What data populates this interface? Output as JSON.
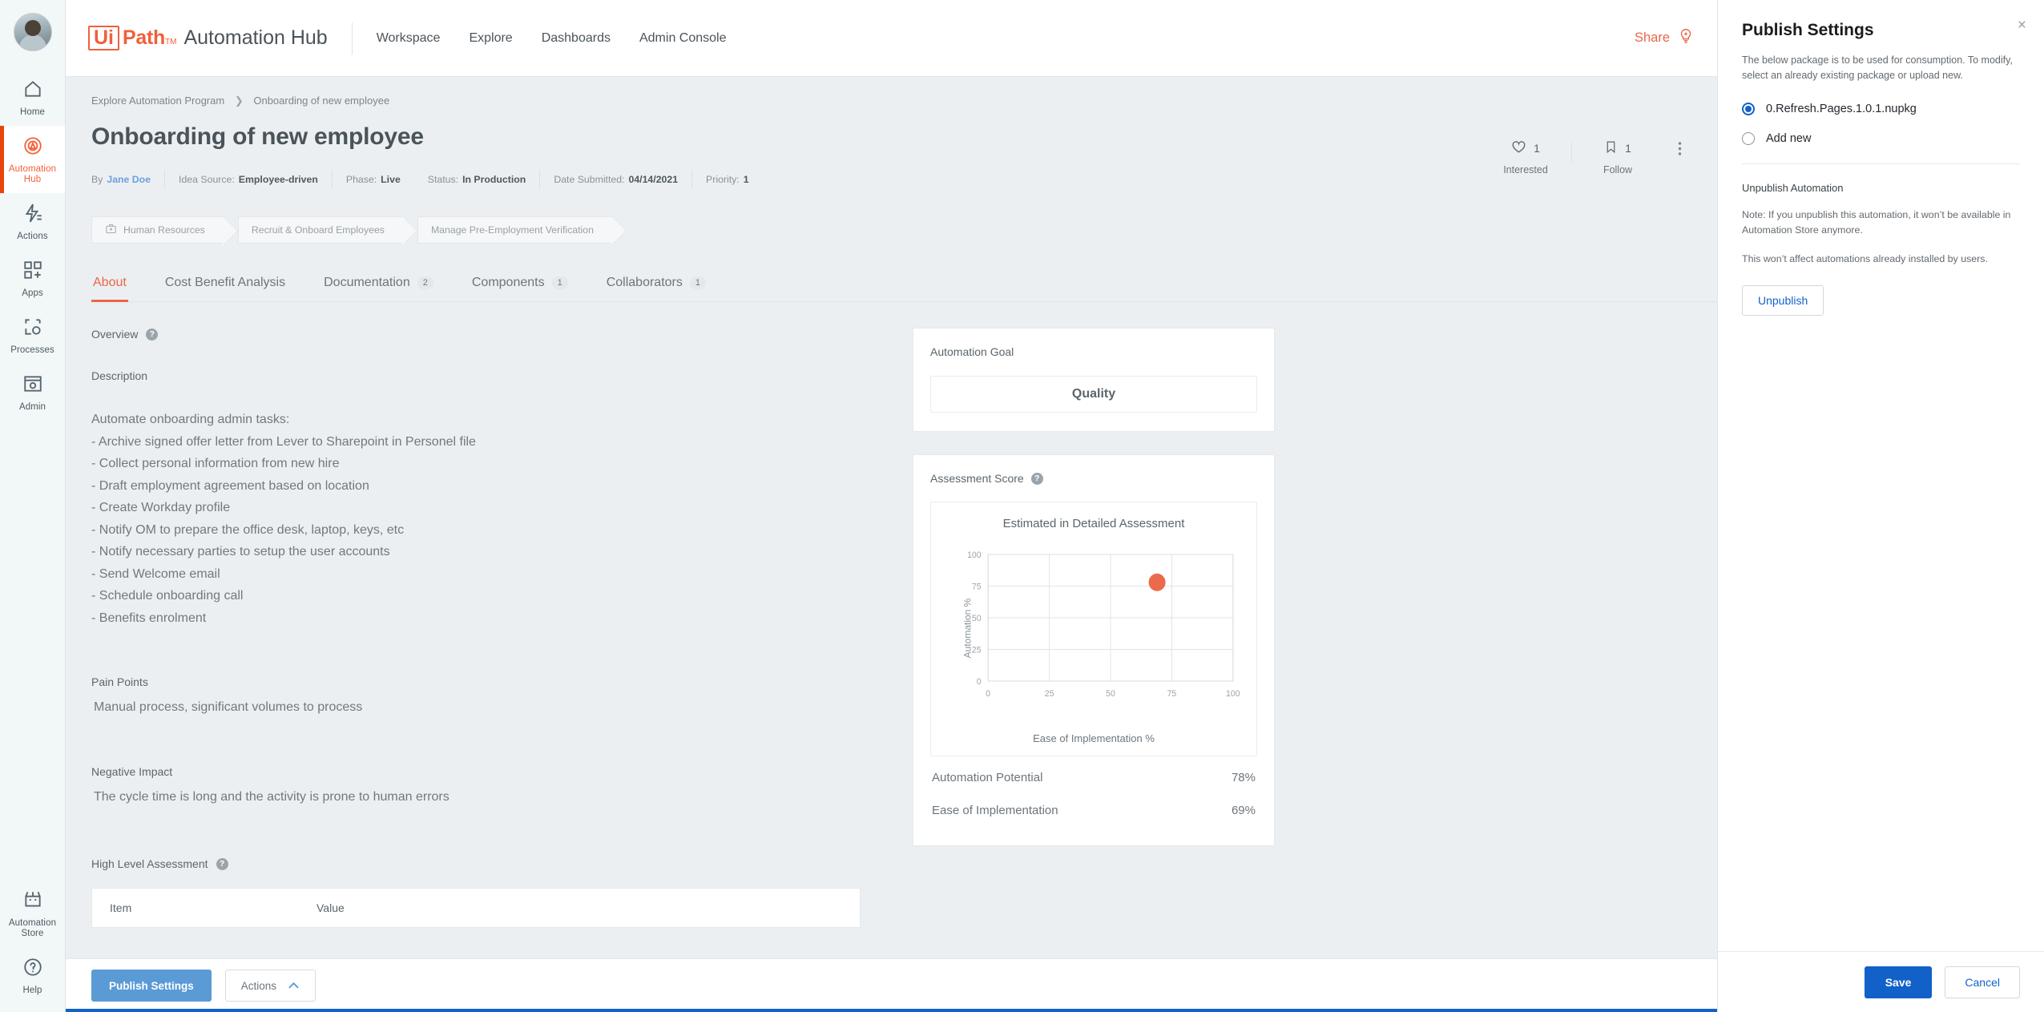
{
  "rail": {
    "items": [
      {
        "label": "Home",
        "icon": "home-icon",
        "active": false
      },
      {
        "label": "Automation Hub",
        "icon": "automation-hub-icon",
        "active": true
      },
      {
        "label": "Actions",
        "icon": "actions-icon",
        "active": false
      },
      {
        "label": "Apps",
        "icon": "apps-icon",
        "active": false
      },
      {
        "label": "Processes",
        "icon": "processes-icon",
        "active": false
      },
      {
        "label": "Admin",
        "icon": "admin-icon",
        "active": false
      }
    ],
    "bottom": [
      {
        "label": "Automation Store",
        "icon": "automation-store-icon"
      },
      {
        "label": "Help",
        "icon": "help-icon"
      }
    ]
  },
  "topbar": {
    "logo_ui": "Ui",
    "logo_path": "Path",
    "logo_tm": "TM",
    "product": "Automation Hub",
    "nav": [
      {
        "label": "Workspace"
      },
      {
        "label": "Explore"
      },
      {
        "label": "Dashboards"
      },
      {
        "label": "Admin Console"
      }
    ],
    "share_label": "Share"
  },
  "breadcrumb": {
    "parent": "Explore Automation Program",
    "separator": "❯",
    "current": "Onboarding of new employee"
  },
  "page": {
    "title": "Onboarding of new employee"
  },
  "meta": {
    "by_label": "By",
    "author": "Jane Doe",
    "items": [
      {
        "key": "Idea Source:",
        "value": "Employee-driven"
      },
      {
        "key": "Phase:",
        "value": "Live"
      },
      {
        "key": "Status:",
        "value": "In Production"
      },
      {
        "key": "Date Submitted:",
        "value": "04/14/2021"
      },
      {
        "key": "Priority:",
        "value": "1"
      }
    ]
  },
  "engagement": {
    "interested_count": "1",
    "interested_label": "Interested",
    "follow_count": "1",
    "follow_label": "Follow"
  },
  "chips": [
    {
      "label": "Human Resources",
      "icon": "briefcase-icon"
    },
    {
      "label": "Recruit & Onboard Employees",
      "icon": ""
    },
    {
      "label": "Manage Pre-Employment Verification",
      "icon": ""
    }
  ],
  "tabs": [
    {
      "label": "About",
      "badge": "",
      "active": true
    },
    {
      "label": "Cost Benefit Analysis",
      "badge": "",
      "active": false
    },
    {
      "label": "Documentation",
      "badge": "2",
      "active": false
    },
    {
      "label": "Components",
      "badge": "1",
      "active": false
    },
    {
      "label": "Collaborators",
      "badge": "1",
      "active": false
    }
  ],
  "about": {
    "overview_label": "Overview",
    "description_label": "Description",
    "description_lines": [
      "Automate onboarding admin tasks:",
      "- Archive signed offer letter from Lever to Sharepoint in Personel file",
      "- Collect personal information from new hire",
      "- Draft employment agreement based on location",
      "- Create Workday profile",
      "- Notify OM to prepare the office desk, laptop, keys, etc",
      "- Notify necessary parties to setup the user accounts",
      "- Send Welcome email",
      "- Schedule onboarding call",
      "- Benefits enrolment"
    ],
    "pain_points_label": "Pain Points",
    "pain_points_text": "Manual process, significant volumes to process",
    "negative_impact_label": "Negative Impact",
    "negative_impact_text": "The cycle time is long and the activity is prone to human errors",
    "high_level_assessment_label": "High Level Assessment",
    "hl_table_headers": [
      "Item",
      "Value"
    ]
  },
  "automation_goal": {
    "title": "Automation Goal",
    "value": "Quality"
  },
  "assessment": {
    "title": "Assessment Score",
    "metrics": [
      {
        "label": "Automation Potential",
        "value": "78%"
      },
      {
        "label": "Ease of Implementation",
        "value": "69%"
      }
    ]
  },
  "chart_data": {
    "type": "scatter",
    "title": "Estimated in Detailed Assessment",
    "xlabel": "Ease of Implementation %",
    "ylabel": "Automation %",
    "xlim": [
      0,
      100
    ],
    "ylim": [
      0,
      100
    ],
    "xticks": [
      "0",
      "25",
      "50",
      "75",
      "100"
    ],
    "yticks": [
      "0",
      "25",
      "50",
      "75",
      "100"
    ],
    "grid": true,
    "legend": "none",
    "point_color": "#ec6a4c",
    "series": [
      {
        "name": "Onboarding of new employee",
        "x": [
          69
        ],
        "y": [
          78
        ]
      }
    ]
  },
  "bottom_bar": {
    "publish_settings_label": "Publish Settings",
    "actions_label": "Actions",
    "actions_caret": "⌃"
  },
  "publish_panel": {
    "title": "Publish Settings",
    "close_glyph": "×",
    "description": "The below package is to be used for consumption. To modify, select an already existing package or upload new.",
    "options": [
      {
        "label": "0.Refresh.Pages.1.0.1.nupkg",
        "selected": true
      },
      {
        "label": "Add new",
        "selected": false
      }
    ],
    "unpublish_section_title": "Unpublish Automation",
    "note_1": "Note: If you unpublish this automation, it won’t be available in Automation Store anymore.",
    "note_2": "This won’t affect automations already installed by users.",
    "unpublish_button": "Unpublish",
    "save_label": "Save",
    "cancel_label": "Cancel"
  },
  "colors": {
    "brand_orange": "#f0603c",
    "accent_blue": "#1261c8",
    "soft_blue": "#5b9bd5",
    "chart_point": "#ec6a4c"
  }
}
